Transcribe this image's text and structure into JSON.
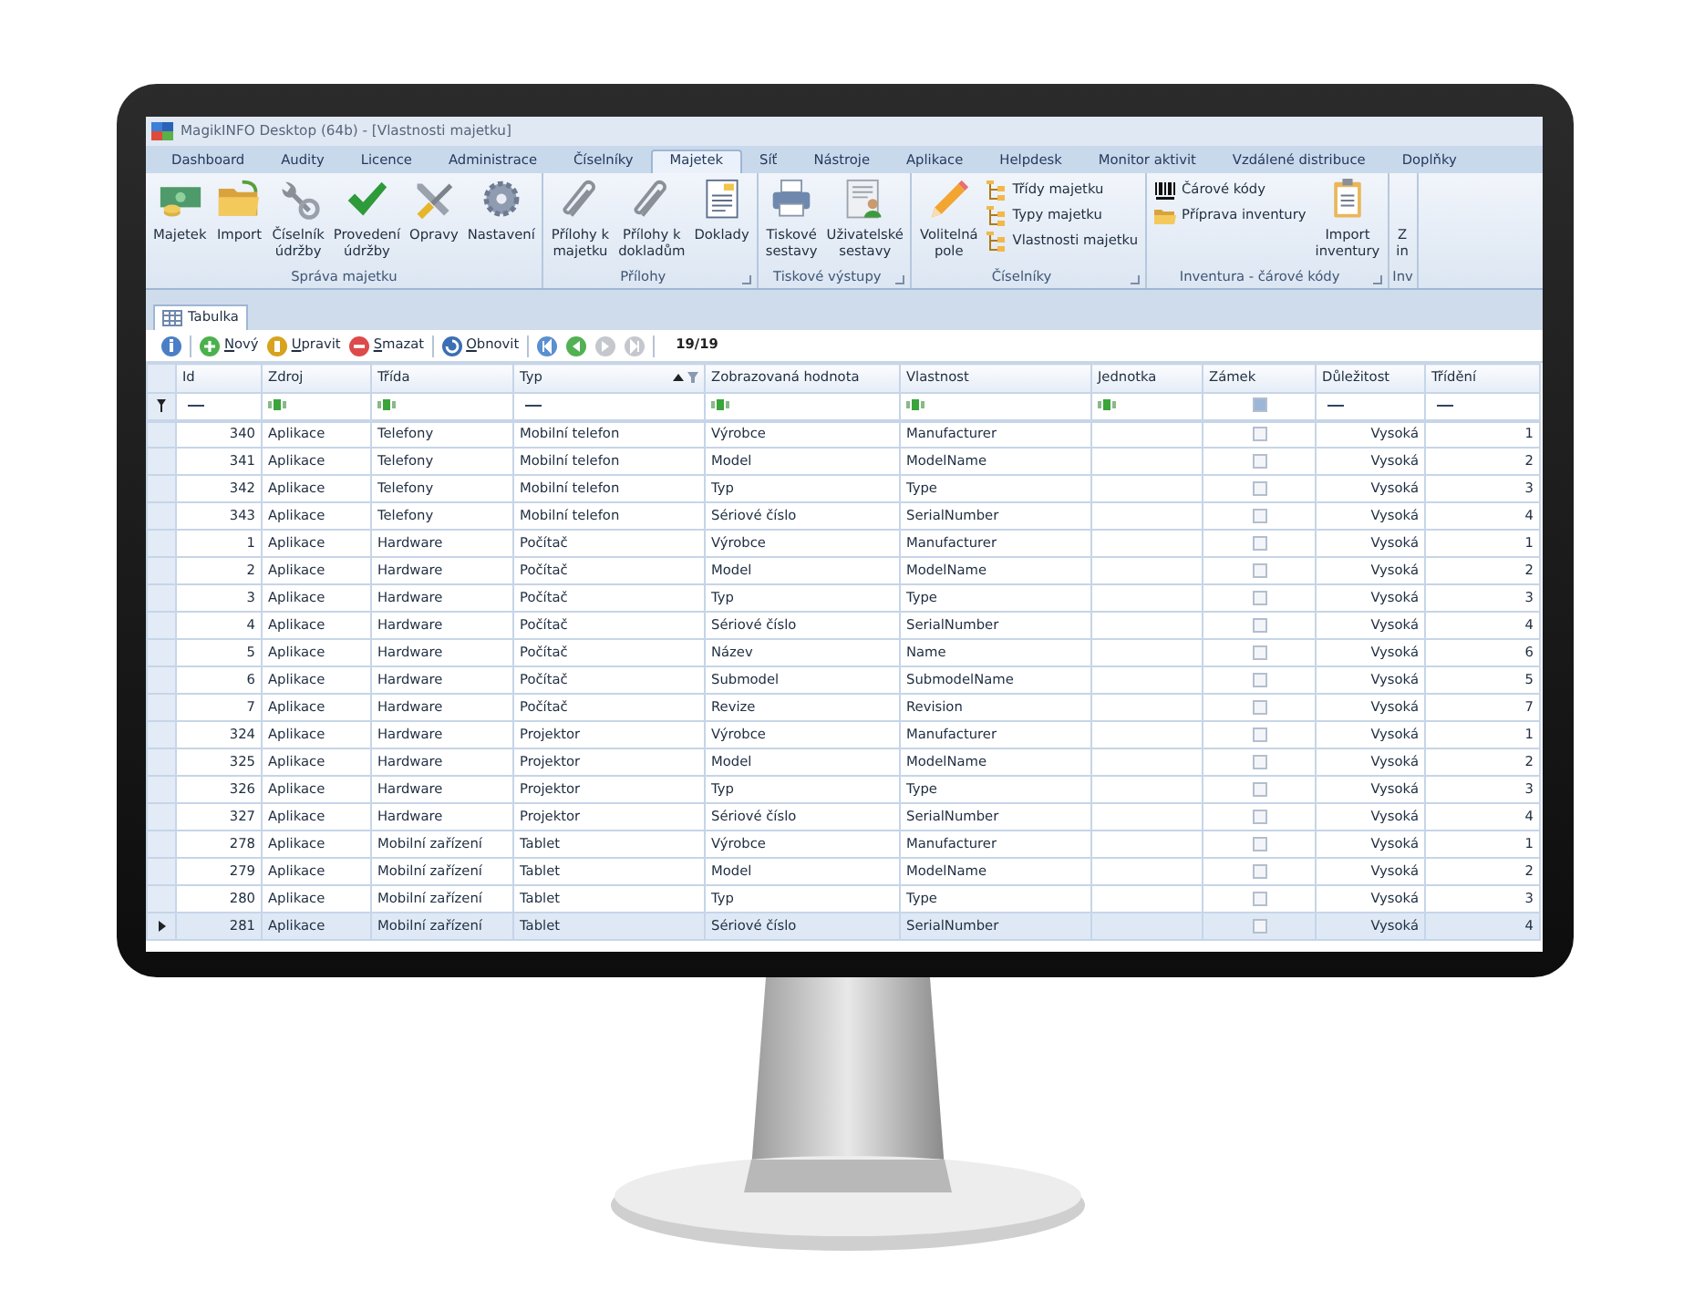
{
  "window": {
    "title": "MagikINFO Desktop (64b) - [Vlastnosti majetku]"
  },
  "tabs": [
    {
      "label": "Dashboard",
      "selected": false
    },
    {
      "label": "Audity",
      "selected": false
    },
    {
      "label": "Licence",
      "selected": false
    },
    {
      "label": "Administrace",
      "selected": false
    },
    {
      "label": "Číselníky",
      "selected": false
    },
    {
      "label": "Majetek",
      "selected": true
    },
    {
      "label": "Síť",
      "selected": false
    },
    {
      "label": "Nástroje",
      "selected": false
    },
    {
      "label": "Aplikace",
      "selected": false
    },
    {
      "label": "Helpdesk",
      "selected": false
    },
    {
      "label": "Monitor aktivit",
      "selected": false
    },
    {
      "label": "Vzdálené distribuce",
      "selected": false
    },
    {
      "label": "Doplňky",
      "selected": false
    }
  ],
  "ribbon": [
    {
      "label": "Správa majetku",
      "launcher": false,
      "buttons": [
        {
          "kind": "large",
          "label": "Majetek"
        },
        {
          "kind": "large",
          "label": "Import"
        },
        {
          "kind": "large",
          "label": "Číselník\núdržby"
        },
        {
          "kind": "large",
          "label": "Provedení\núdržby"
        },
        {
          "kind": "large",
          "label": "Opravy"
        },
        {
          "kind": "large",
          "label": "Nastavení"
        }
      ]
    },
    {
      "label": "Přílohy",
      "launcher": true,
      "buttons": [
        {
          "kind": "large",
          "label": "Přílohy k\nmajetku"
        },
        {
          "kind": "large",
          "label": "Přílohy k\ndokladům"
        },
        {
          "kind": "large",
          "label": "Doklady"
        }
      ]
    },
    {
      "label": "Tiskové výstupy",
      "launcher": true,
      "buttons": [
        {
          "kind": "large",
          "label": "Tiskové\nsestavy"
        },
        {
          "kind": "large",
          "label": "Uživatelské\nsestavy"
        }
      ]
    },
    {
      "label": "Číselníky",
      "launcher": true,
      "buttons": [
        {
          "kind": "large",
          "label": "Volitelná\npole"
        },
        {
          "kind": "small",
          "label": "Třídy majetku"
        },
        {
          "kind": "small",
          "label": "Typy majetku"
        },
        {
          "kind": "small",
          "label": "Vlastnosti majetku"
        }
      ]
    },
    {
      "label": "Inventura - čárové kódy",
      "launcher": true,
      "buttons": [
        {
          "kind": "small",
          "label": "Čárové kódy"
        },
        {
          "kind": "small",
          "label": "Příprava inventury"
        },
        {
          "kind": "large",
          "label": "Import\ninventury"
        }
      ]
    },
    {
      "label": "Inv",
      "launcher": false,
      "buttons": [
        {
          "kind": "cut",
          "label": "Z\nin"
        }
      ]
    }
  ],
  "document_tabs": [
    {
      "label": "Tabulka",
      "selected": true
    }
  ],
  "toolbar": {
    "buttons": [
      {
        "kind": "info"
      },
      {
        "kind": "add",
        "label": "Nový"
      },
      {
        "kind": "edit",
        "label": "Upravit"
      },
      {
        "kind": "delete",
        "label": "Smazat"
      },
      {
        "kind": "refresh",
        "label": "Obnovit"
      },
      {
        "kind": "first",
        "disabled": false
      },
      {
        "kind": "prev",
        "disabled": false
      },
      {
        "kind": "next",
        "disabled": true
      },
      {
        "kind": "last",
        "disabled": true
      }
    ],
    "count": "19/19"
  },
  "table": {
    "columns": [
      {
        "label": "Id",
        "kind": "number"
      },
      {
        "label": "Zdroj",
        "kind": "text"
      },
      {
        "label": "Třída",
        "kind": "text"
      },
      {
        "label": "Typ",
        "kind": "text",
        "sorted_ascending": true,
        "filter_button": true
      },
      {
        "label": "Zobrazovaná hodnota",
        "kind": "text"
      },
      {
        "label": "Vlastnost",
        "kind": "text"
      },
      {
        "label": "Jednotka",
        "kind": "text"
      },
      {
        "label": "Zámek",
        "kind": "check"
      },
      {
        "label": "Důležitost",
        "kind": "choice"
      },
      {
        "label": "Třídění",
        "kind": "number"
      }
    ],
    "filter_row": [
      {
        "kind": "dash"
      },
      {
        "kind": "abc"
      },
      {
        "kind": "abc"
      },
      {
        "kind": "dash"
      },
      {
        "kind": "abc"
      },
      {
        "kind": "abc"
      },
      {
        "kind": "abc"
      },
      {
        "kind": "check",
        "checked": true
      },
      {
        "kind": "dash"
      },
      {
        "kind": "dash"
      }
    ],
    "rows": [
      {
        "cells": [
          "340",
          "Aplikace",
          "Telefony",
          "Mobilní telefon",
          "Výrobce",
          "Manufacturer",
          ""
        ],
        "locked": false,
        "importance": "Vysoká",
        "order": "1",
        "selected": false
      },
      {
        "cells": [
          "341",
          "Aplikace",
          "Telefony",
          "Mobilní telefon",
          "Model",
          "ModelName",
          ""
        ],
        "locked": false,
        "importance": "Vysoká",
        "order": "2",
        "selected": false
      },
      {
        "cells": [
          "342",
          "Aplikace",
          "Telefony",
          "Mobilní telefon",
          "Typ",
          "Type",
          ""
        ],
        "locked": false,
        "importance": "Vysoká",
        "order": "3",
        "selected": false
      },
      {
        "cells": [
          "343",
          "Aplikace",
          "Telefony",
          "Mobilní telefon",
          "Sériové číslo",
          "SerialNumber",
          ""
        ],
        "locked": false,
        "importance": "Vysoká",
        "order": "4",
        "selected": false
      },
      {
        "cells": [
          "1",
          "Aplikace",
          "Hardware",
          "Počítač",
          "Výrobce",
          "Manufacturer",
          ""
        ],
        "locked": false,
        "importance": "Vysoká",
        "order": "1",
        "selected": false
      },
      {
        "cells": [
          "2",
          "Aplikace",
          "Hardware",
          "Počítač",
          "Model",
          "ModelName",
          ""
        ],
        "locked": false,
        "importance": "Vysoká",
        "order": "2",
        "selected": false
      },
      {
        "cells": [
          "3",
          "Aplikace",
          "Hardware",
          "Počítač",
          "Typ",
          "Type",
          ""
        ],
        "locked": false,
        "importance": "Vysoká",
        "order": "3",
        "selected": false
      },
      {
        "cells": [
          "4",
          "Aplikace",
          "Hardware",
          "Počítač",
          "Sériové číslo",
          "SerialNumber",
          ""
        ],
        "locked": false,
        "importance": "Vysoká",
        "order": "4",
        "selected": false
      },
      {
        "cells": [
          "5",
          "Aplikace",
          "Hardware",
          "Počítač",
          "Název",
          "Name",
          ""
        ],
        "locked": false,
        "importance": "Vysoká",
        "order": "6",
        "selected": false
      },
      {
        "cells": [
          "6",
          "Aplikace",
          "Hardware",
          "Počítač",
          "Submodel",
          "SubmodelName",
          ""
        ],
        "locked": false,
        "importance": "Vysoká",
        "order": "5",
        "selected": false
      },
      {
        "cells": [
          "7",
          "Aplikace",
          "Hardware",
          "Počítač",
          "Revize",
          "Revision",
          ""
        ],
        "locked": false,
        "importance": "Vysoká",
        "order": "7",
        "selected": false
      },
      {
        "cells": [
          "324",
          "Aplikace",
          "Hardware",
          "Projektor",
          "Výrobce",
          "Manufacturer",
          ""
        ],
        "locked": false,
        "importance": "Vysoká",
        "order": "1",
        "selected": false
      },
      {
        "cells": [
          "325",
          "Aplikace",
          "Hardware",
          "Projektor",
          "Model",
          "ModelName",
          ""
        ],
        "locked": false,
        "importance": "Vysoká",
        "order": "2",
        "selected": false
      },
      {
        "cells": [
          "326",
          "Aplikace",
          "Hardware",
          "Projektor",
          "Typ",
          "Type",
          ""
        ],
        "locked": false,
        "importance": "Vysoká",
        "order": "3",
        "selected": false
      },
      {
        "cells": [
          "327",
          "Aplikace",
          "Hardware",
          "Projektor",
          "Sériové číslo",
          "SerialNumber",
          ""
        ],
        "locked": false,
        "importance": "Vysoká",
        "order": "4",
        "selected": false
      },
      {
        "cells": [
          "278",
          "Aplikace",
          "Mobilní zařízení",
          "Tablet",
          "Výrobce",
          "Manufacturer",
          ""
        ],
        "locked": false,
        "importance": "Vysoká",
        "order": "1",
        "selected": false
      },
      {
        "cells": [
          "279",
          "Aplikace",
          "Mobilní zařízení",
          "Tablet",
          "Model",
          "ModelName",
          ""
        ],
        "locked": false,
        "importance": "Vysoká",
        "order": "2",
        "selected": false
      },
      {
        "cells": [
          "280",
          "Aplikace",
          "Mobilní zařízení",
          "Tablet",
          "Typ",
          "Type",
          ""
        ],
        "locked": false,
        "importance": "Vysoká",
        "order": "3",
        "selected": false
      },
      {
        "cells": [
          "281",
          "Aplikace",
          "Mobilní zařízení",
          "Tablet",
          "Sériové číslo",
          "SerialNumber",
          ""
        ],
        "locked": false,
        "importance": "Vysoká",
        "order": "4",
        "selected": true
      }
    ]
  }
}
